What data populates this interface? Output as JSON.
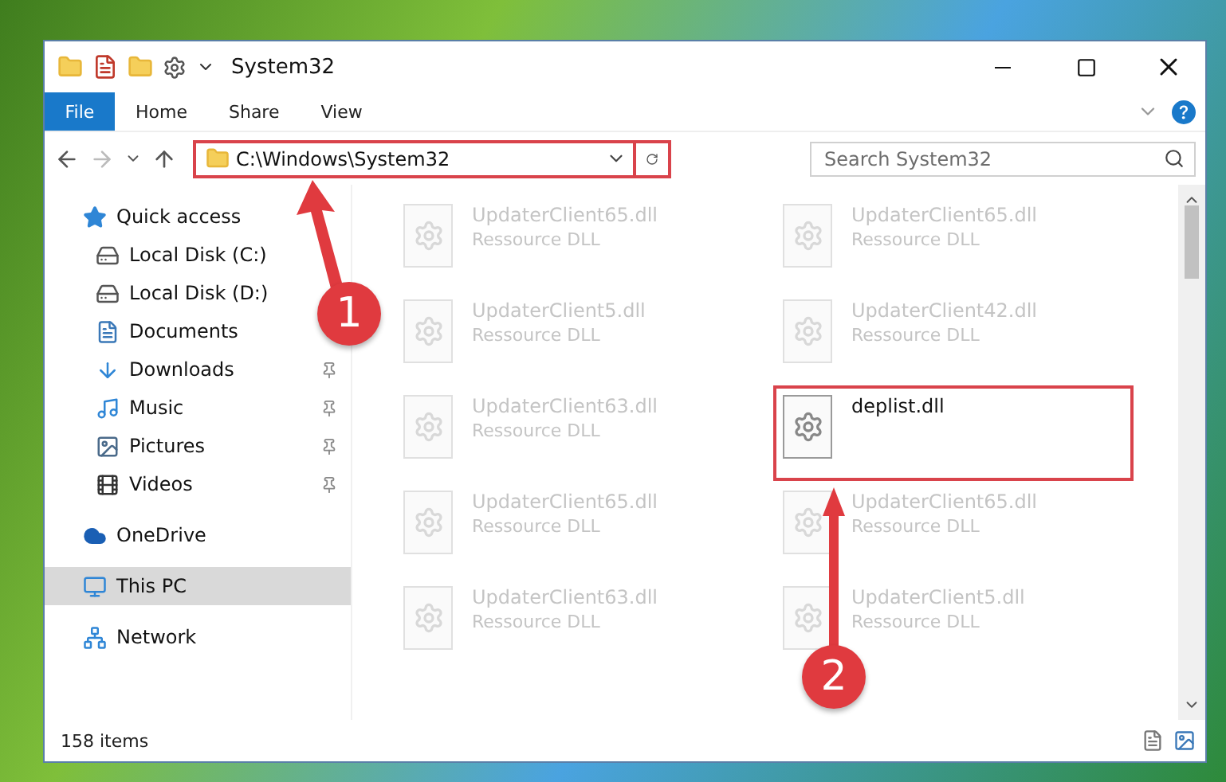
{
  "window": {
    "title": "System32"
  },
  "ribbon_tabs": [
    {
      "label": "File",
      "selected": true
    },
    {
      "label": "Home",
      "selected": false
    },
    {
      "label": "Share",
      "selected": false
    },
    {
      "label": "View",
      "selected": false
    }
  ],
  "address": {
    "path": "C:\\Windows\\System32"
  },
  "search": {
    "placeholder": "Search System32"
  },
  "sidebar": {
    "items": [
      {
        "label": "Quick access",
        "kind": "star",
        "selected": false,
        "pinned": false,
        "children": [
          {
            "label": "Local Disk (C:)",
            "kind": "disk",
            "selected": false,
            "pinned": false
          },
          {
            "label": "Local Disk (D:)",
            "kind": "disk",
            "selected": false,
            "pinned": false
          },
          {
            "label": "Documents",
            "kind": "document",
            "selected": false,
            "pinned": false
          },
          {
            "label": "Downloads",
            "kind": "download",
            "selected": false,
            "pinned": true
          },
          {
            "label": "Music",
            "kind": "music",
            "selected": false,
            "pinned": true
          },
          {
            "label": "Pictures",
            "kind": "picture",
            "selected": false,
            "pinned": true
          },
          {
            "label": "Videos",
            "kind": "video",
            "selected": false,
            "pinned": true
          }
        ]
      },
      {
        "label": "OneDrive",
        "kind": "cloud",
        "selected": false,
        "pinned": false
      },
      {
        "label": "This PC",
        "kind": "pc",
        "selected": true,
        "pinned": false
      },
      {
        "label": "Network",
        "kind": "network",
        "selected": false,
        "pinned": false
      }
    ]
  },
  "files": [
    {
      "name": "UpdaterClient65.dll",
      "type": "Ressource DLL",
      "dimmed": true
    },
    {
      "name": "UpdaterClient65.dll",
      "type": "Ressource DLL",
      "dimmed": true
    },
    {
      "name": "UpdaterClient5.dll",
      "type": "Ressource DLL",
      "dimmed": true
    },
    {
      "name": "UpdaterClient42.dll",
      "type": "Ressource DLL",
      "dimmed": true
    },
    {
      "name": "UpdaterClient63.dll",
      "type": "Ressource DLL",
      "dimmed": true
    },
    {
      "name": "deplist.dll",
      "dimmed": false,
      "highlighted": true
    },
    {
      "name": "UpdaterClient65.dll",
      "type": "Ressource DLL",
      "dimmed": true
    },
    {
      "name": "UpdaterClient65.dll",
      "type": "Ressource DLL",
      "dimmed": true
    },
    {
      "name": "UpdaterClient63.dll",
      "type": "Ressource DLL",
      "dimmed": true
    },
    {
      "name": "UpdaterClient5.dll",
      "type": "Ressource DLL",
      "dimmed": true
    }
  ],
  "status_bar": {
    "count": "158 items"
  },
  "annotations": [
    {
      "number": "1"
    },
    {
      "number": "2"
    }
  ]
}
